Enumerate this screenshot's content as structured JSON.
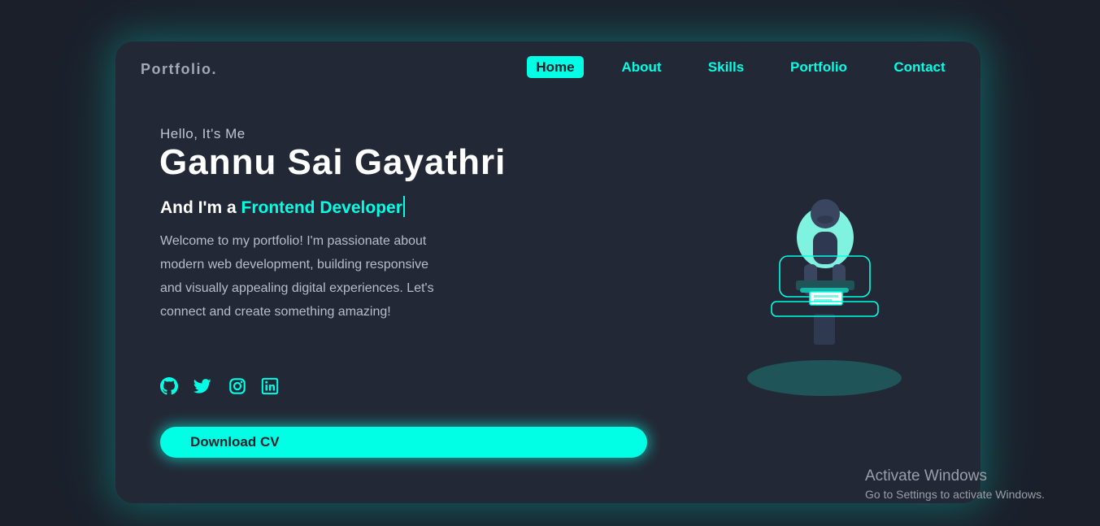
{
  "header": {
    "logo": "Portfolio.",
    "nav": [
      {
        "label": "Home",
        "active": true
      },
      {
        "label": "About",
        "active": false
      },
      {
        "label": "Skills",
        "active": false
      },
      {
        "label": "Portfolio",
        "active": false
      },
      {
        "label": "Contact",
        "active": false
      }
    ]
  },
  "hero": {
    "greeting": "Hello, It's Me",
    "name": "Gannu Sai Gayathri",
    "role_prefix": "And I'm a ",
    "role_highlight": "Frontend Developer",
    "description": "Welcome to my portfolio! I'm passionate about modern web development, building responsive and visually appealing digital experiences. Let's connect and create something amazing!",
    "socials": [
      {
        "icon": "github-icon"
      },
      {
        "icon": "twitter-icon"
      },
      {
        "icon": "instagram-icon"
      },
      {
        "icon": "linkedin-icon"
      }
    ],
    "cta_label": "Download CV"
  },
  "watermark": {
    "title": "Activate Windows",
    "subtitle": "Go to Settings to activate Windows."
  },
  "colors": {
    "accent": "#00ffe5",
    "background": "#1b1f2a",
    "card": "#232836",
    "text_muted": "#b9bdc9"
  }
}
